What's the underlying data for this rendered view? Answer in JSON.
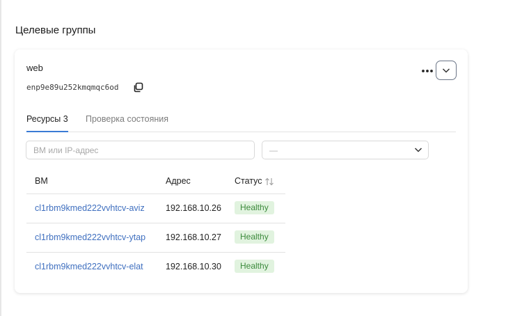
{
  "section": {
    "title": "Целевые группы"
  },
  "group": {
    "name": "web",
    "id": "enp9e89u252kmqmqc6od",
    "copy_icon": "copy-icon",
    "more_icon": "more-horizontal-icon",
    "expand_icon": "chevron-down-icon"
  },
  "tabs": [
    {
      "label": "Ресурсы 3",
      "active": true
    },
    {
      "label": "Проверка состояния",
      "active": false
    }
  ],
  "filters": {
    "search_placeholder": "ВМ или IP-адрес",
    "search_value": "",
    "status_value": "—",
    "status_icon": "chevron-down-icon"
  },
  "table": {
    "headers": {
      "vm": "ВМ",
      "address": "Адрес",
      "status": "Статус"
    },
    "sort_icon": "sort-arrows-icon",
    "rows": [
      {
        "vm": "cl1rbm9kmed222vvhtcv-aviz",
        "address": "192.168.10.26",
        "status": "Healthy"
      },
      {
        "vm": "cl1rbm9kmed222vvhtcv-ytap",
        "address": "192.168.10.27",
        "status": "Healthy"
      },
      {
        "vm": "cl1rbm9kmed222vvhtcv-elat",
        "address": "192.168.10.30",
        "status": "Healthy"
      }
    ]
  },
  "colors": {
    "link": "#3f6fbf",
    "tab_active_underline": "#3a7bd5",
    "healthy_bg": "#e1f3df",
    "healthy_text": "#3c8a3c"
  }
}
